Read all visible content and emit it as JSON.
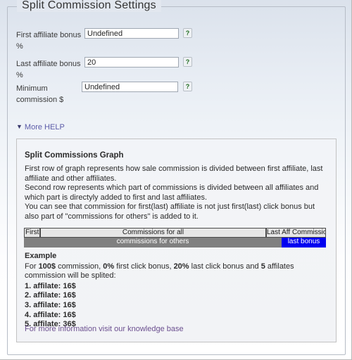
{
  "fieldset": {
    "legend": "Split Commission Settings"
  },
  "form": {
    "rows": [
      {
        "label": "First affiliate bonus %",
        "value": "Undefined",
        "placeholder": "Undefined",
        "help_icon": "?"
      },
      {
        "label": "Last affiliate bonus %",
        "value": "20",
        "placeholder": "",
        "help_icon": "?"
      },
      {
        "label": "Minimum commission $",
        "value": "Undefined",
        "placeholder": "Undefined",
        "help_icon": "?"
      }
    ]
  },
  "more_help": {
    "arrow": "▼",
    "label": "More HELP"
  },
  "help_panel": {
    "title": "Split Commissions Graph",
    "paragraphs": [
      "First row of graph represents how sale commission is divided between first affiliate, last affiliate and other affiliates.",
      "Second row represents which part of commissions is divided between all affiliates and which part is directyly added to first and last affiliates.",
      "You can see that commission for first(last) affiliate is not just first(last) click bonus but also part of \"commissions for others\" is added to it."
    ],
    "graph": {
      "row1": [
        {
          "label": "First Af",
          "style": "light"
        },
        {
          "label": "Commissions for all",
          "style": "light"
        },
        {
          "label": "Last Aff Commission",
          "style": "light"
        }
      ],
      "row2": [
        {
          "label": "commissions for others",
          "style": "gray"
        },
        {
          "label": "last bonus",
          "style": "blue"
        }
      ]
    },
    "example": {
      "title": "Example",
      "intro_prefix": "For ",
      "intro": "For 100$ commission, 0% first click bonus, 20% last click bonus and 5 affilates commission will be splited:",
      "affiliates": [
        "1. affilate: 16$",
        "2. affilate: 16$",
        "3. affilate: 16$",
        "4. affilate: 16$",
        "5. affilate: 36$"
      ]
    },
    "kb_link": "For more information visit our knowledge base"
  },
  "colors": {
    "bar_gray": "#808080",
    "bar_blue": "#0000f0",
    "bar_light": "#e6e6e6",
    "link": "#6b4f8f",
    "more_help_link": "#5b5ba8"
  }
}
